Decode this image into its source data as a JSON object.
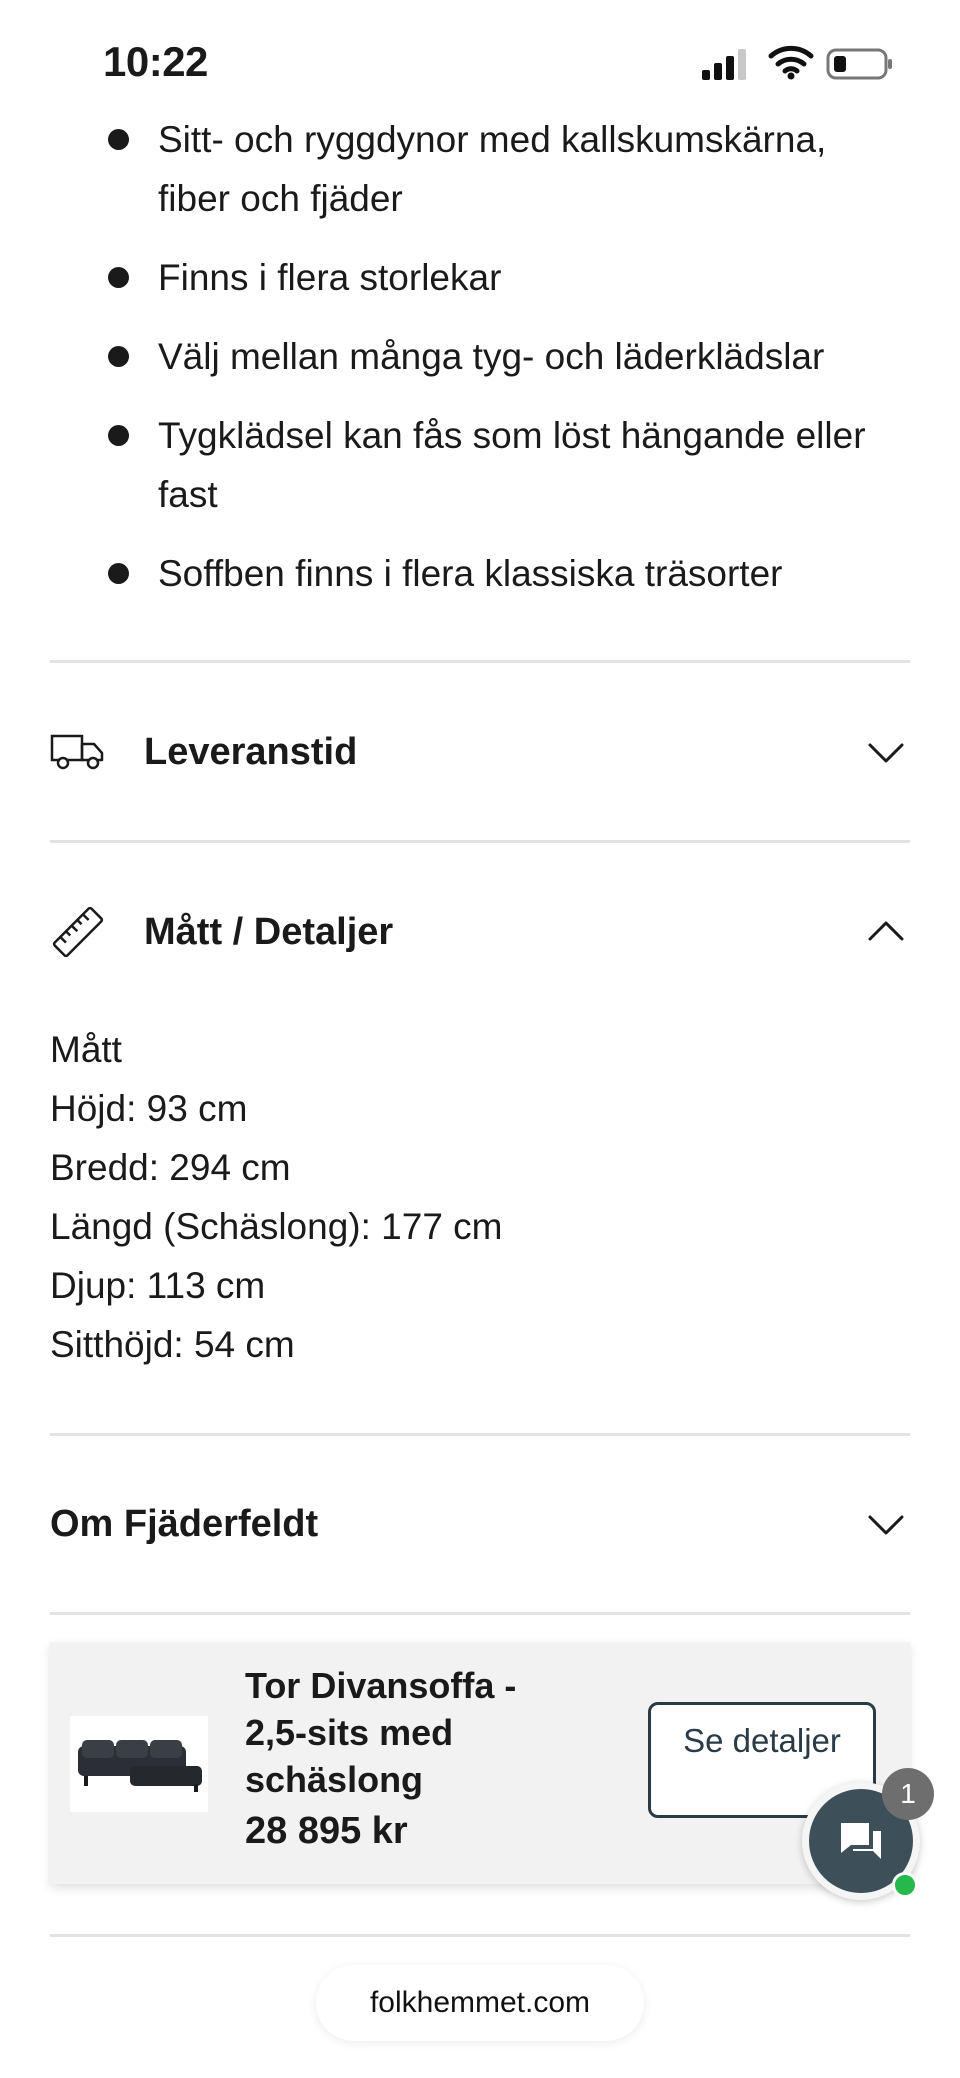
{
  "status_bar": {
    "time": "10:22",
    "icons": [
      "cellular-signal-icon",
      "wifi-icon",
      "battery-icon"
    ]
  },
  "features": [
    "Sitt- och ryggdynor med kallskumskärna, fiber och fjäder",
    "Finns i flera storlekar",
    "Välj mellan många tyg- och läderklädslar",
    "Tygklädsel kan fås som löst hängande eller fast",
    "Soffben finns i flera klassiska träsorter"
  ],
  "accordions": {
    "delivery": {
      "title": "Leveranstid",
      "icon": "truck-icon",
      "expanded": false
    },
    "dimensions": {
      "title": "Mått / Detaljer",
      "icon": "ruler-icon",
      "expanded": true
    },
    "brand": {
      "title": "Om Fjäderfeldt",
      "expanded": false
    }
  },
  "dimensions_details": {
    "heading": "Mått",
    "lines": [
      "Höjd: 93 cm",
      "Bredd: 294 cm",
      "Längd (Schäslong): 177 cm",
      "Djup: 113 cm",
      "Sitthöjd: 54 cm"
    ]
  },
  "product_card": {
    "name": "Tor Divansoffa - 2,5-sits med schäslong",
    "price": "28 895 kr",
    "button_label": "Se detaljer"
  },
  "chat": {
    "badge_count": "1",
    "online": true
  },
  "browser": {
    "url": "folkhemmet.com"
  },
  "colors": {
    "text": "#1a1a1a",
    "divider": "#e3e3e3",
    "card_bg": "#f2f2f2",
    "button_border": "#2b3a44",
    "chat_bg": "#3d5059",
    "online_green": "#25b84a"
  }
}
